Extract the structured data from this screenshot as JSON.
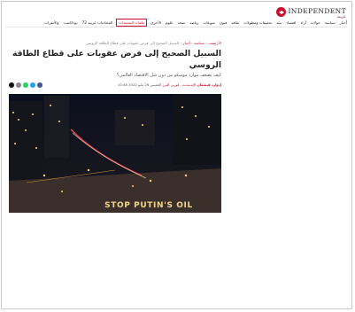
{
  "logo": {
    "name": "INDEPENDENT",
    "sub": "عربية"
  },
  "nav": {
    "items": [
      "أخبار",
      "سياسة",
      "جولات",
      "آراء",
      "اقتصاد",
      "بيئة",
      "تحقيقات ومطولات",
      "ثقافة",
      "فنون",
      "منوعات",
      "رياضة",
      "صحة",
      "علوم",
      "الأخرى",
      "ملفات المحتجات",
      "المحادثات عربية 72",
      "بودكاست",
      "والأنقرات"
    ],
    "active_index": 14
  },
  "breadcrumb": {
    "part1": "الأرشيف",
    "sep": "›",
    "part2": "سياسة",
    "part3": "أخبار",
    "current": "السبيل الصحيح إلى فرض عقوبات على قطاع الطاقة الروسي"
  },
  "article": {
    "headline": "السبيل الصحيح إلى فرض عقوبات على قطاع الطاقة الروسي",
    "subtitle": "كيف تضعف موارد موسكو من دون شل الاقتصاد العالمي؟",
    "author": "إدوارد فيشمان",
    "section": "الإندبندنت - فورين أفيرز",
    "date": "الخميس 26 مايو 2022 10:48"
  },
  "photo": {
    "caption_text": "STOP PUTIN'S OIL"
  },
  "colors": {
    "accent": "#c8102e"
  }
}
